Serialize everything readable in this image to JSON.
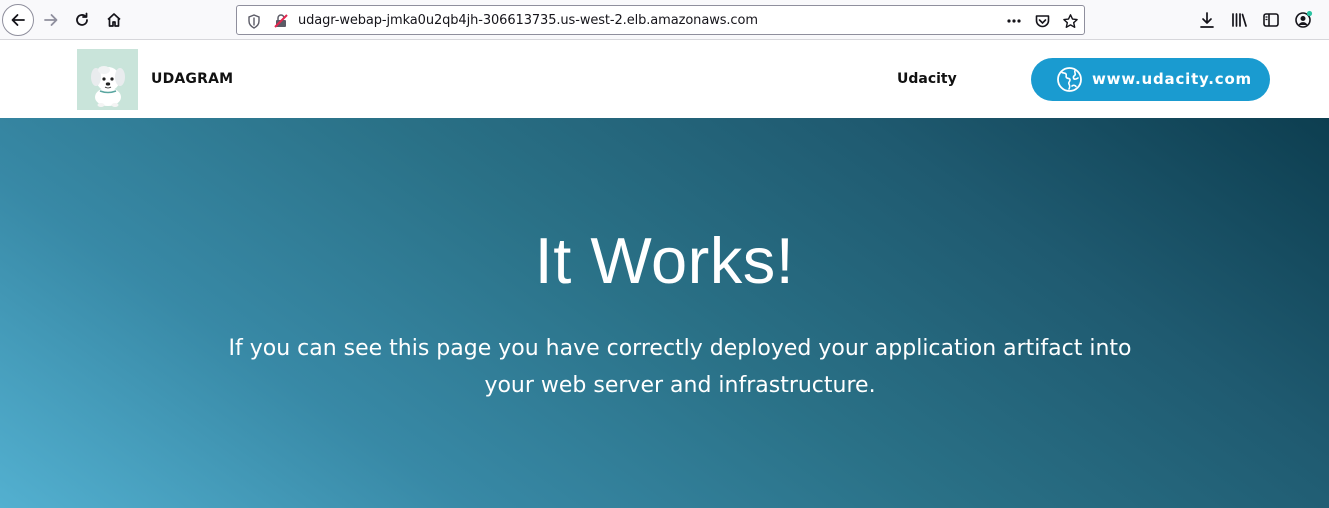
{
  "browser": {
    "url": "udagr-webap-jmka0u2qb4jh-306613735.us-west-2.elb.amazonaws.com"
  },
  "header": {
    "brand": "UDAGRAM",
    "nav_link": "Udacity",
    "cta_label": "www.udacity.com"
  },
  "hero": {
    "title": "It Works!",
    "text": "If you can see this page you have correctly deployed your application artifact into your web server and infrastructure."
  },
  "colors": {
    "cta": "#1a9bd0",
    "hero_start": "#53b0d0",
    "hero_end": "#0d3e50"
  }
}
